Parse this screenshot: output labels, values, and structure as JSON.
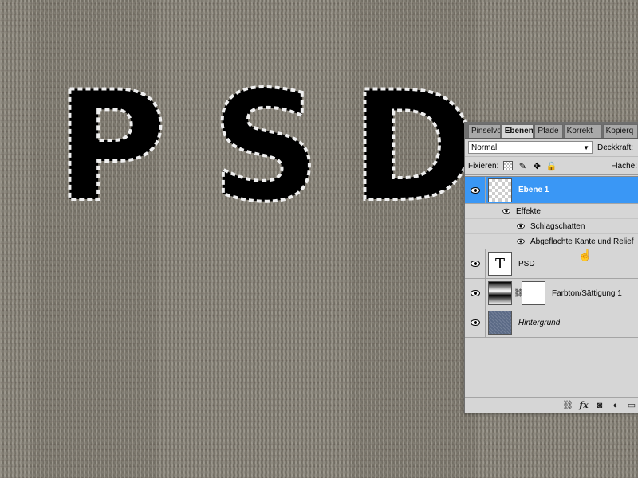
{
  "canvas": {
    "artwork_text": "PSD"
  },
  "panel": {
    "tabs": [
      "Pinselvo",
      "Ebenen",
      "Pfade",
      "Korrekt",
      "Kopierq"
    ],
    "active_tab": "Ebenen",
    "blend_mode": "Normal",
    "opacity_label": "Deckkraft:",
    "lock_label": "Fixieren:",
    "fill_label": "Fläche:"
  },
  "layers": {
    "ebene1": "Ebene 1",
    "effects_label": "Effekte",
    "effect1": "Schlagschatten",
    "effect2": "Abgeflachte Kante und Relief",
    "text_layer": "PSD",
    "text_thumb": "T",
    "adjustment": "Farbton/Sättigung 1",
    "background": "Hintergrund"
  },
  "icons": {
    "link": "link-icon",
    "fx": "fx-icon",
    "mask": "layer-mask-icon",
    "adjust": "adjustment-layer-icon",
    "folder": "new-group-icon"
  },
  "footer": {
    "fx_label": "fx"
  },
  "colors": {
    "selection": "#3a97f5"
  }
}
